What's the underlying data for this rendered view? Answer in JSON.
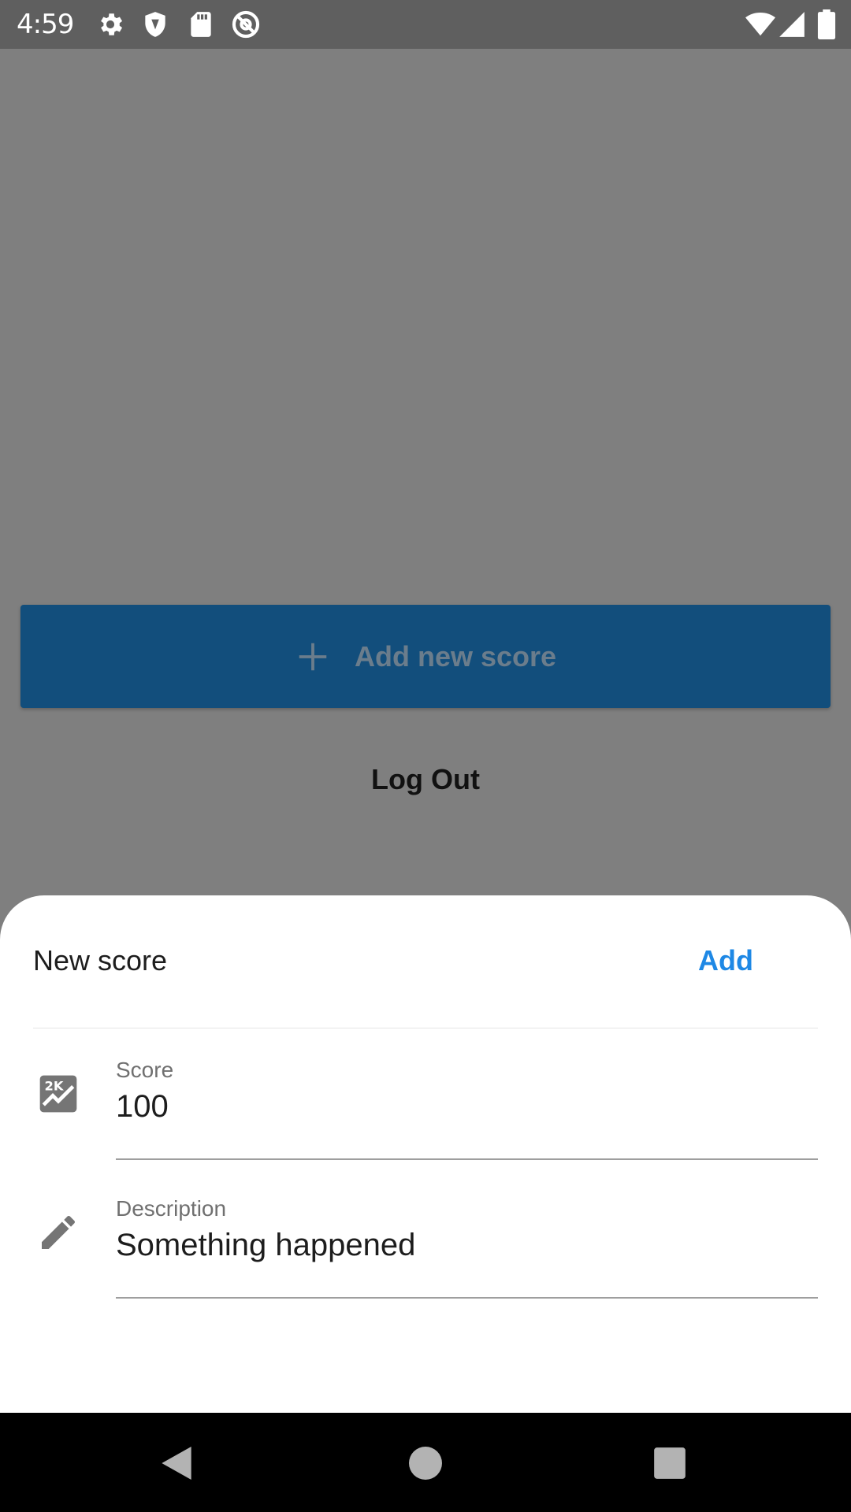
{
  "status_bar": {
    "time": "4:59",
    "left_icons": [
      "gear-icon",
      "shield-icon",
      "sd-card-icon",
      "at-sign-icon"
    ],
    "right_icons": [
      "wifi-icon",
      "signal-icon",
      "battery-icon"
    ]
  },
  "background": {
    "add_score_label": "Add new score",
    "logout_label": "Log Out",
    "accent_color": "#124e7c"
  },
  "sheet": {
    "title": "New score",
    "add_label": "Add",
    "add_color": "#1e88e5",
    "fields": [
      {
        "icon": "score-chart-icon",
        "label": "Score",
        "value": "100"
      },
      {
        "icon": "pencil-icon",
        "label": "Description",
        "value": "Something happened"
      }
    ]
  },
  "nav_bar": {
    "buttons": [
      "back-icon",
      "home-icon",
      "recents-icon"
    ]
  }
}
